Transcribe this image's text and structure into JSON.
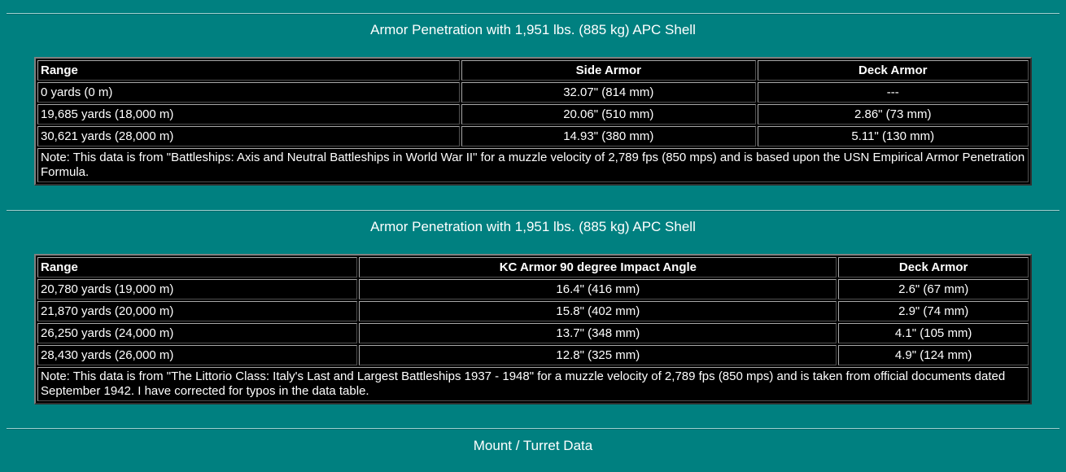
{
  "sections": [
    {
      "title": "Armor Penetration with 1,951 lbs. (885 kg) APC Shell",
      "headers": [
        "Range",
        "Side Armor",
        "Deck Armor"
      ],
      "rows": [
        [
          "0 yards (0 m)",
          "32.07\" (814 mm)",
          "---"
        ],
        [
          "19,685 yards (18,000 m)",
          "20.06\" (510 mm)",
          "2.86\" (73 mm)"
        ],
        [
          "30,621 yards (28,000 m)",
          "14.93\" (380 mm)",
          "5.11\" (130 mm)"
        ]
      ],
      "note": "Note:  This data is from \"Battleships:  Axis and Neutral Battleships in World War II\" for a muzzle velocity of 2,789 fps (850 mps) and is based upon the USN Empirical Armor Penetration Formula."
    },
    {
      "title": "Armor Penetration with 1,951 lbs. (885 kg) APC Shell",
      "headers": [
        "Range",
        "KC Armor 90 degree Impact Angle",
        "Deck Armor"
      ],
      "rows": [
        [
          "20,780 yards (19,000 m)",
          "16.4\" (416 mm)",
          "2.6\" (67 mm)"
        ],
        [
          "21,870 yards (20,000 m)",
          "15.8\" (402 mm)",
          "2.9\" (74 mm)"
        ],
        [
          "26,250 yards (24,000 m)",
          "13.7\" (348 mm)",
          "4.1\" (105 mm)"
        ],
        [
          "28,430 yards (26,000 m)",
          "12.8\" (325 mm)",
          "4.9\" (124 mm)"
        ]
      ],
      "note": "Note:  This data is from \"The Littorio Class:  Italy's Last and Largest Battleships 1937 - 1948\" for a muzzle velocity of 2,789 fps (850 mps) and is taken from official documents dated September 1942.  I have corrected for typos in the data table."
    },
    {
      "title": "Mount / Turret Data"
    }
  ],
  "colors": {
    "background": "#008080",
    "table_background": "#000000",
    "text": "#ffffff"
  }
}
